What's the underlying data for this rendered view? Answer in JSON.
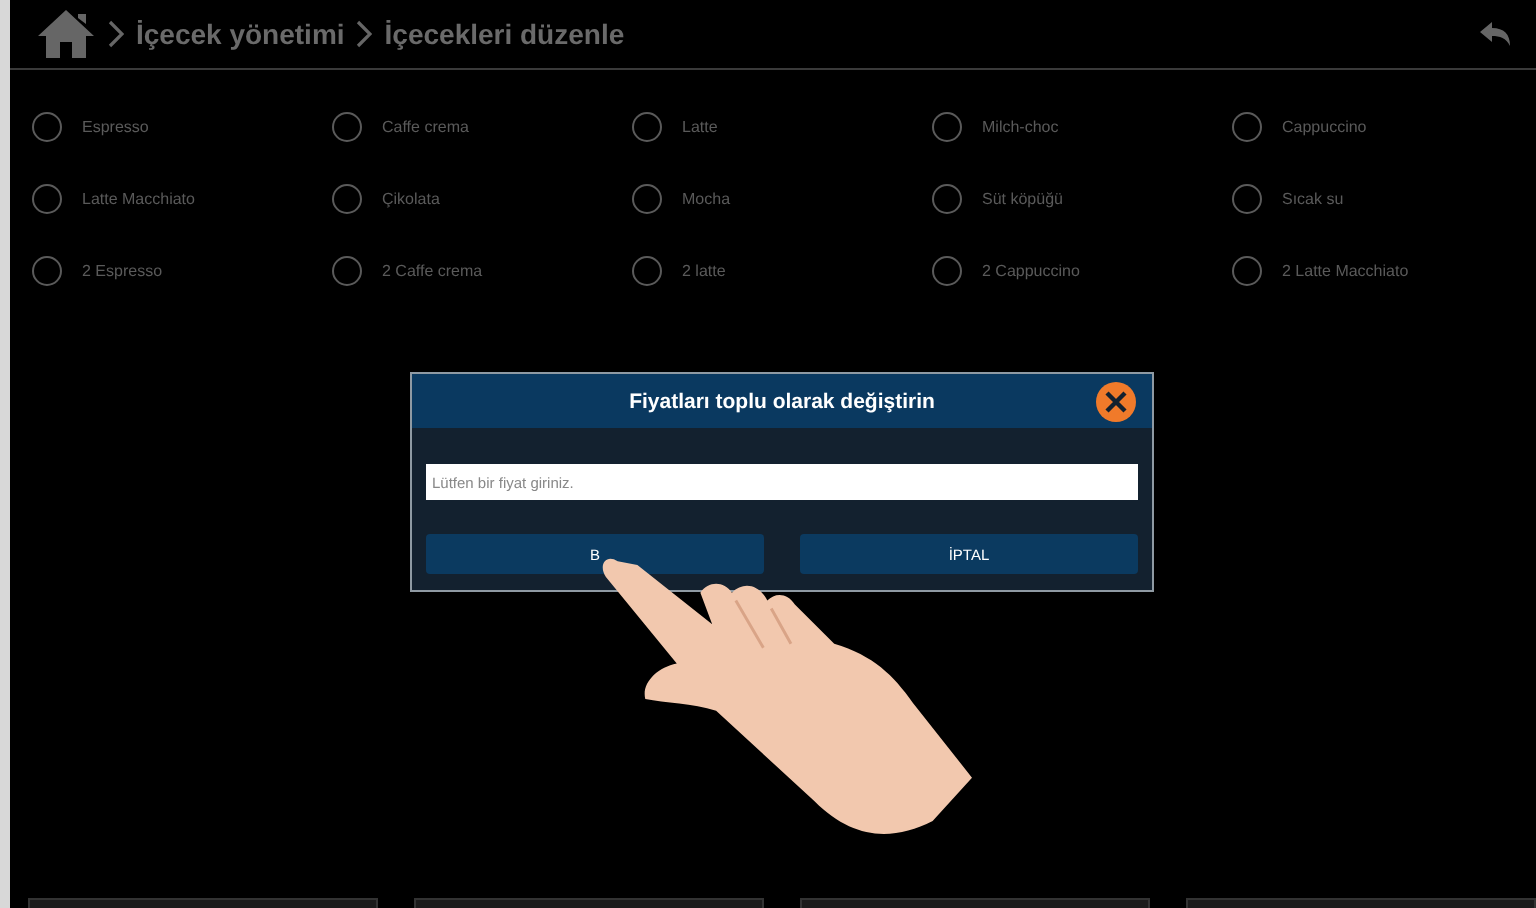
{
  "header": {
    "breadcrumb": [
      {
        "label": "İçecek yönetimi"
      },
      {
        "label": "İçecekleri düzenle"
      }
    ]
  },
  "drinks": [
    {
      "label": "Espresso",
      "selected": false
    },
    {
      "label": "Caffe crema",
      "selected": false
    },
    {
      "label": "Latte",
      "selected": false
    },
    {
      "label": "Milch-choc",
      "selected": false
    },
    {
      "label": "Cappuccino",
      "selected": false
    },
    {
      "label": "Latte Macchiato",
      "selected": false
    },
    {
      "label": "Çikolata",
      "selected": false
    },
    {
      "label": "Mocha",
      "selected": false
    },
    {
      "label": "Süt köpüğü",
      "selected": false
    },
    {
      "label": "Sıcak su",
      "selected": false
    },
    {
      "label": "2 Espresso",
      "selected": false
    },
    {
      "label": "2 Caffe crema",
      "selected": false
    },
    {
      "label": "2 latte",
      "selected": false
    },
    {
      "label": "2 Cappuccino",
      "selected": false
    },
    {
      "label": "2 Latte Macchiato",
      "selected": false
    }
  ],
  "dialog": {
    "title": "Fiyatları toplu olarak değiştirin",
    "placeholder": "Lütfen bir fiyat giriniz.",
    "buttons": [
      "B",
      "İPTAL"
    ]
  }
}
